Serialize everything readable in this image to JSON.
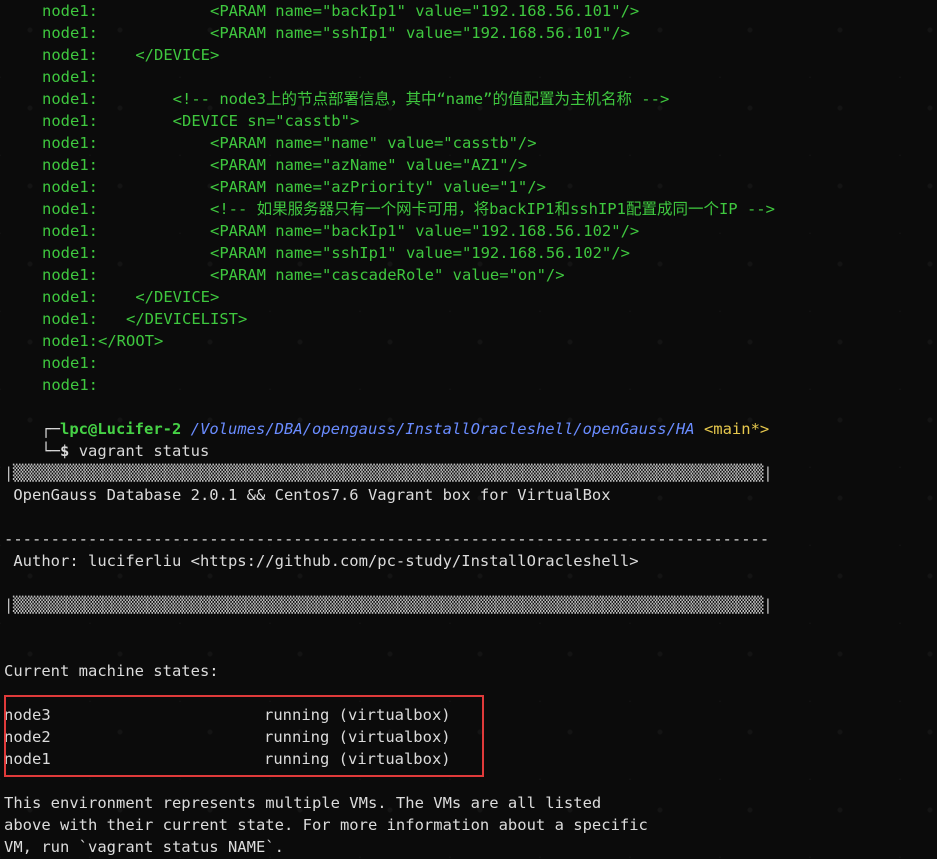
{
  "xml_lines": [
    {
      "prefix": "node1:",
      "text": "            <PARAM name=\"backIp1\" value=\"192.168.56.101\"/>"
    },
    {
      "prefix": "node1:",
      "text": "            <PARAM name=\"sshIp1\" value=\"192.168.56.101\"/>"
    },
    {
      "prefix": "node1:",
      "text": "    </DEVICE>"
    },
    {
      "prefix": "node1:",
      "text": ""
    },
    {
      "prefix": "node1:",
      "text": "        <!-- node3上的节点部署信息，其中“name”的值配置为主机名称 -->"
    },
    {
      "prefix": "node1:",
      "text": "        <DEVICE sn=\"casstb\">"
    },
    {
      "prefix": "node1:",
      "text": "            <PARAM name=\"name\" value=\"casstb\"/>"
    },
    {
      "prefix": "node1:",
      "text": "            <PARAM name=\"azName\" value=\"AZ1\"/>"
    },
    {
      "prefix": "node1:",
      "text": "            <PARAM name=\"azPriority\" value=\"1\"/>"
    },
    {
      "prefix": "node1:",
      "text": "            <!-- 如果服务器只有一个网卡可用，将backIP1和sshIP1配置成同一个IP -->"
    },
    {
      "prefix": "node1:",
      "text": "            <PARAM name=\"backIp1\" value=\"192.168.56.102\"/>"
    },
    {
      "prefix": "node1:",
      "text": "            <PARAM name=\"sshIp1\" value=\"192.168.56.102\"/>"
    },
    {
      "prefix": "node1:",
      "text": "            <PARAM name=\"cascadeRole\" value=\"on\"/>"
    },
    {
      "prefix": "node1:",
      "text": "    </DEVICE>"
    },
    {
      "prefix": "node1:",
      "text": "   </DEVICELIST>"
    },
    {
      "prefix": "node1:",
      "text": "</ROOT>"
    },
    {
      "prefix": "node1:",
      "text": ""
    },
    {
      "prefix": "node1:",
      "text": ""
    }
  ],
  "prompt": {
    "corner_top": "┌─",
    "user": "lpc@Lucifer-2",
    "path": "/Volumes/DBA/opengauss/InstallOracleshell/openGauss/HA",
    "branch": "<main*>",
    "corner_bottom": "└─",
    "symbol": "$",
    "command": "vagrant status"
  },
  "banner": {
    "bar": "|▒▒▒▒▒▒▒▒▒▒▒▒▒▒▒▒▒▒▒▒▒▒▒▒▒▒▒▒▒▒▒▒▒▒▒▒▒▒▒▒▒▒▒▒▒▒▒▒▒▒▒▒▒▒▒▒▒▒▒▒▒▒▒▒▒▒▒▒▒▒▒▒▒▒▒▒▒▒▒▒▒▒▒▒|",
    "title": " OpenGauss Database 2.0.1 && Centos7.6 Vagrant box for VirtualBox",
    "divider": "----------------------------------------------------------------------------------",
    "author": " Author: luciferliu <https://github.com/pc-study/InstallOracleshell>"
  },
  "status": {
    "heading": "Current machine states:",
    "machines": [
      {
        "name": "node3",
        "state": "running (virtualbox)"
      },
      {
        "name": "node2",
        "state": "running (virtualbox)"
      },
      {
        "name": "node1",
        "state": "running (virtualbox)"
      }
    ],
    "footer": [
      "This environment represents multiple VMs. The VMs are all listed",
      "above with their current state. For more information about a specific",
      "VM, run `vagrant status NAME`."
    ]
  },
  "colors": {
    "log_green": "#3fc83f",
    "prompt_user": "#46d246",
    "prompt_path": "#6a8cff",
    "prompt_branch": "#e6c84d",
    "highlight_box": "#e03a3a"
  }
}
